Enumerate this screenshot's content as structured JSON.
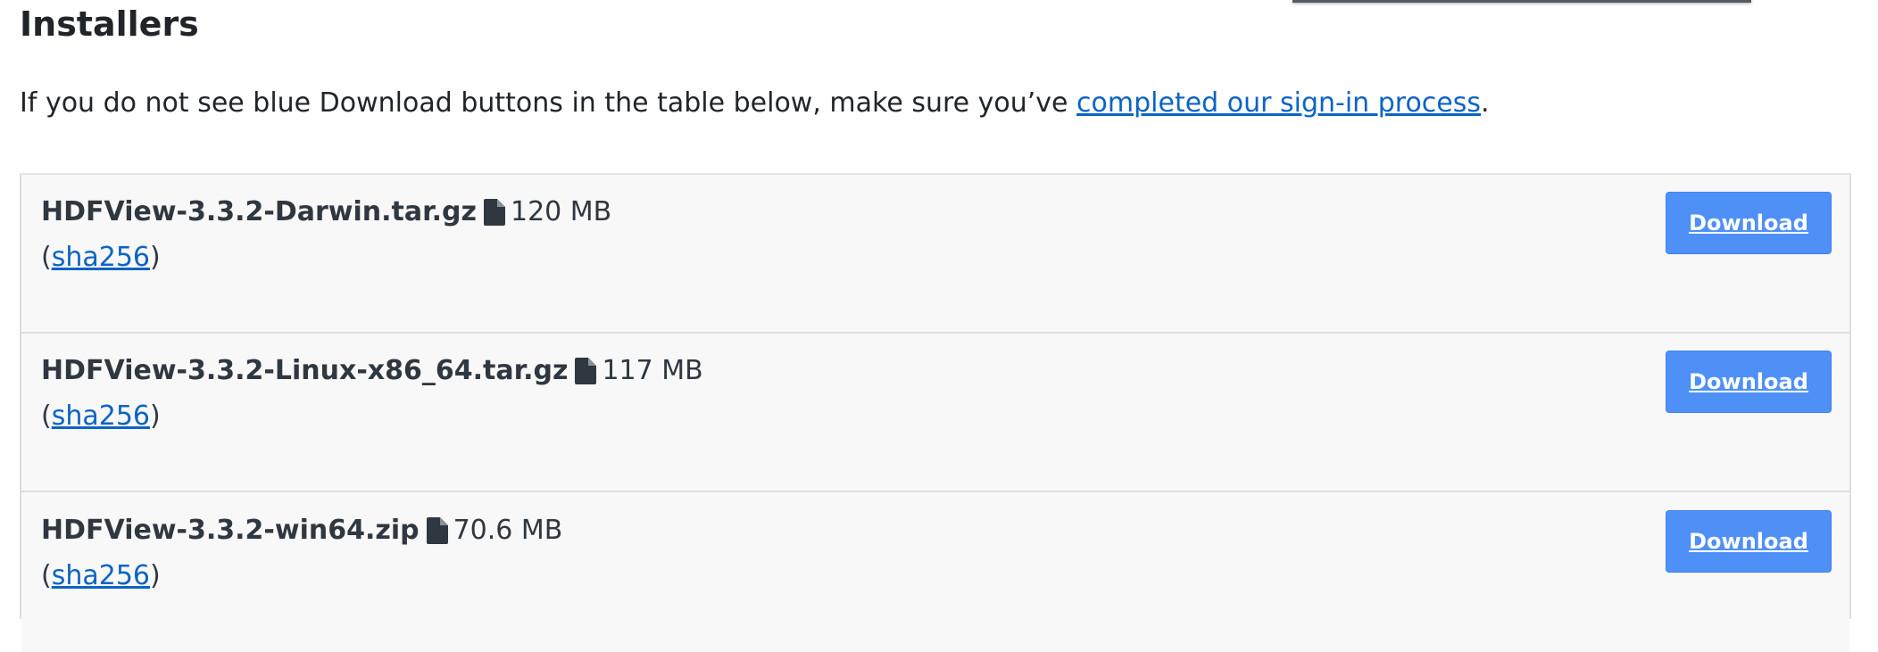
{
  "page": {
    "heading": "Installers",
    "intro_before": "If you do not see blue Download buttons in the table below, make sure you’ve ",
    "intro_link": "completed our sign-in process",
    "intro_after": "."
  },
  "installers": [
    {
      "filename": "HDFView-3.3.2-Darwin.tar.gz",
      "size": "120 MB",
      "sha_open": "(",
      "sha_label": "sha256",
      "sha_close": ")",
      "download_label": "Download"
    },
    {
      "filename": "HDFView-3.3.2-Linux-x86_64.tar.gz",
      "size": "117 MB",
      "sha_open": "(",
      "sha_label": "sha256",
      "sha_close": ")",
      "download_label": "Download"
    },
    {
      "filename": "HDFView-3.3.2-win64.zip",
      "size": "70.6 MB",
      "sha_open": "(",
      "sha_label": "sha256",
      "sha_close": ")",
      "download_label": "Download"
    }
  ],
  "icons": {
    "file_size_icon": "file-icon"
  },
  "colors": {
    "text": "#212529",
    "link": "#0b64c4",
    "download_button": "#4f90f7",
    "row_background": "#f8f8f8",
    "row_border": "#dedede"
  }
}
